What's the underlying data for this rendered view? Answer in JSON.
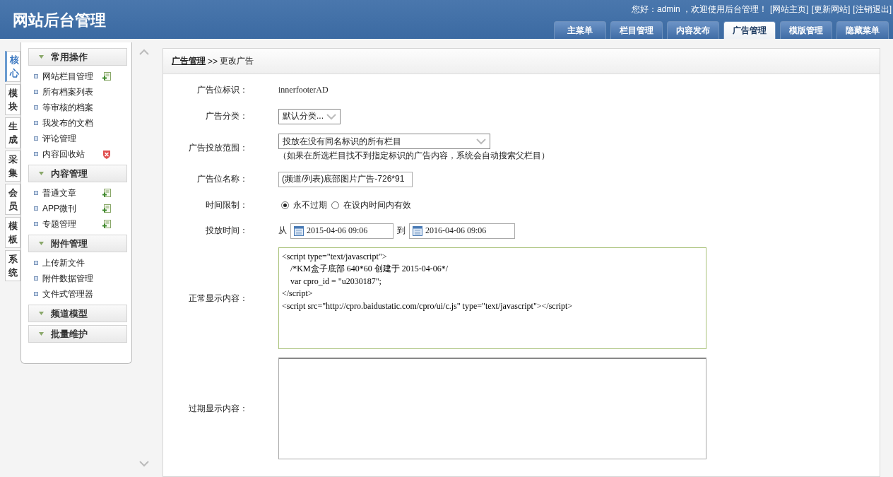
{
  "header": {
    "title": "网站后台管理",
    "greeting": "您好：admin ，欢迎使用后台管理！",
    "links": [
      "[网站主页]",
      "[更新网站]",
      "[注销退出]"
    ],
    "tabs": [
      {
        "label": "主菜单",
        "selected": false
      },
      {
        "label": "栏目管理",
        "selected": false
      },
      {
        "label": "内容发布",
        "selected": false
      },
      {
        "label": "广告管理",
        "selected": true
      },
      {
        "label": "模版管理",
        "selected": false
      },
      {
        "label": "隐藏菜单",
        "selected": false
      }
    ]
  },
  "side_tabs": [
    {
      "label": "核心",
      "selected": true
    },
    {
      "label": "模块",
      "selected": false
    },
    {
      "label": "生成",
      "selected": false
    },
    {
      "label": "采集",
      "selected": false
    },
    {
      "label": "会员",
      "selected": false
    },
    {
      "label": "模板",
      "selected": false
    },
    {
      "label": "系统",
      "selected": false
    }
  ],
  "menu": [
    {
      "title": "常用操作",
      "items": [
        {
          "label": "网站栏目管理",
          "kind": "add"
        },
        {
          "label": "所有档案列表",
          "kind": "plain"
        },
        {
          "label": "等审核的档案",
          "kind": "plain"
        },
        {
          "label": "我发布的文档",
          "kind": "plain"
        },
        {
          "label": "评论管理",
          "kind": "plain"
        },
        {
          "label": "内容回收站",
          "kind": "remove"
        }
      ]
    },
    {
      "title": "内容管理",
      "items": [
        {
          "label": "普通文章",
          "kind": "add"
        },
        {
          "label": "APP微刊",
          "kind": "add"
        },
        {
          "label": "专题管理",
          "kind": "add"
        }
      ]
    },
    {
      "title": "附件管理",
      "items": [
        {
          "label": "上传新文件",
          "kind": "plain"
        },
        {
          "label": "附件数据管理",
          "kind": "plain"
        },
        {
          "label": "文件式管理器",
          "kind": "plain"
        }
      ]
    },
    {
      "title": "频道模型"
    },
    {
      "title": "批量维护"
    }
  ],
  "breadcrumb": {
    "section": "广告管理",
    "separator": ">>",
    "page": "更改广告"
  },
  "form": [
    {
      "kind": "text",
      "label": "广告位标识：",
      "value": "innerfooterAD"
    },
    {
      "kind": "select",
      "label": "广告分类：",
      "value": "默认分类..."
    },
    {
      "kind": "select-wide",
      "label": "广告投放范围：",
      "value": "投放在没有同名标识的所有栏目",
      "note": "（如果在所选栏目找不到指定标识的广告内容，系统会自动搜索父栏目）"
    },
    {
      "kind": "input",
      "label": "广告位名称：",
      "value": "(频道/列表)底部图片广告-726*91"
    },
    {
      "kind": "radio",
      "label": "时间限制：",
      "options": [
        {
          "label": "永不过期",
          "selected": true
        },
        {
          "label": "在设内时间内有效",
          "selected": false
        }
      ]
    },
    {
      "kind": "daterange",
      "label": "投放时间：",
      "from_label": "从",
      "from": "2015-04-06 09:06",
      "to_label": "到",
      "to": "2016-04-06 09:06"
    },
    {
      "kind": "textarea",
      "label": "正常显示内容：",
      "value": "<script type=\"text/javascript\">\n    /*KM盒子底部 640*60 创建于 2015-04-06*/\n    var cpro_id = \"u2030187\";\n</script>\n<script src=\"http://cpro.baidustatic.com/cpro/ui/c.js\" type=\"text/javascript\"></script>",
      "focused": true
    },
    {
      "kind": "textarea",
      "label": "过期显示内容：",
      "focused": false
    }
  ]
}
